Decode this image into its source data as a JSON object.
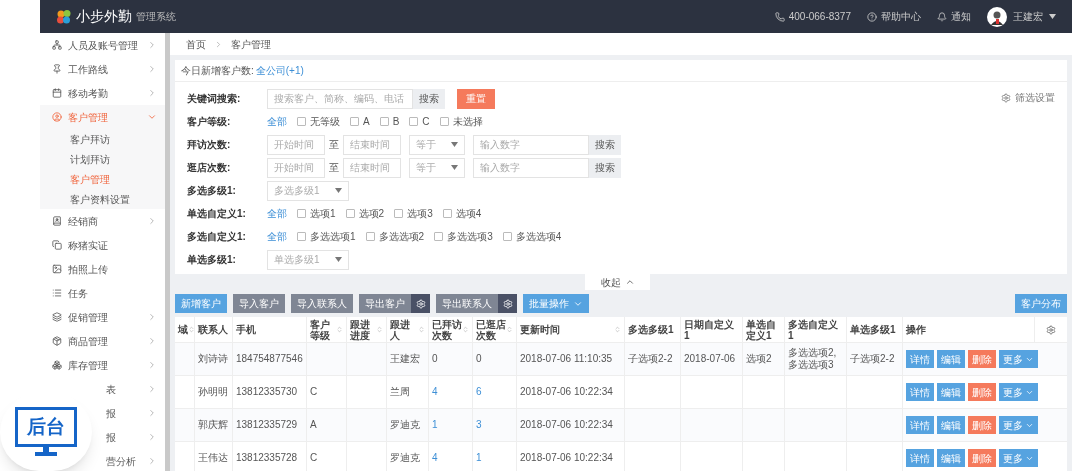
{
  "header": {
    "logo_text": "小步外勤",
    "subtitle": "管理系统",
    "phone": "400-066-8377",
    "help": "帮助中心",
    "notify": "通知",
    "user": "王建宏"
  },
  "sidebar": {
    "items": [
      {
        "label": "人员及账号管理",
        "expanded": false,
        "selected": false
      },
      {
        "label": "工作路线",
        "expanded": false,
        "selected": false
      },
      {
        "label": "移动考勤",
        "expanded": false,
        "selected": false
      },
      {
        "label": "客户管理",
        "expanded": true,
        "selected": true,
        "children": [
          {
            "label": "客户拜访",
            "selected": false
          },
          {
            "label": "计划拜访",
            "selected": false
          },
          {
            "label": "客户管理",
            "selected": true
          },
          {
            "label": "客户资料设置",
            "selected": false
          }
        ]
      },
      {
        "label": "经销商",
        "expanded": false,
        "selected": false
      },
      {
        "label": "称猪实证",
        "selected": false
      },
      {
        "label": "拍照上传",
        "selected": false
      },
      {
        "label": "任务",
        "selected": false
      },
      {
        "label": "促销管理",
        "expanded": false,
        "selected": false
      },
      {
        "label": "商品管理",
        "expanded": false,
        "selected": false
      },
      {
        "label": "库存管理",
        "expanded": false,
        "selected": false
      },
      {
        "label": "表",
        "expanded": false,
        "covered": true
      },
      {
        "label": "报",
        "expanded": false,
        "covered": true
      },
      {
        "label": "报",
        "expanded": false,
        "covered": true
      },
      {
        "label": "营分析",
        "expanded": false,
        "covered": true
      }
    ]
  },
  "badge": {
    "label": "后台"
  },
  "breadcrumb": [
    "首页",
    "客户管理"
  ],
  "today": {
    "label": "今日新增客户数:",
    "link": "全公司(+1)"
  },
  "filter_settings": "筛选设置",
  "filters": [
    {
      "kind": "search",
      "label": "关键词搜索:",
      "placeholder": "搜索客户、简称、编码、电话",
      "button": "搜索",
      "reset": "重置"
    },
    {
      "kind": "options",
      "label": "客户等级:",
      "all": "全部",
      "options": [
        {
          "label": "无等级",
          "checked": false
        },
        {
          "label": "A",
          "checked": false
        },
        {
          "label": "B",
          "checked": false
        },
        {
          "label": "C",
          "checked": false
        },
        {
          "label": "未选择",
          "checked": false
        }
      ]
    },
    {
      "kind": "range",
      "label": "拜访次数:",
      "start": "开始时间",
      "sep": "至",
      "end": "结束时间",
      "operator": "等于",
      "number": "输入数字",
      "button": "搜索"
    },
    {
      "kind": "range",
      "label": "逛店次数:",
      "start": "开始时间",
      "sep": "至",
      "end": "结束时间",
      "operator": "等于",
      "number": "输入数字",
      "button": "搜索"
    },
    {
      "kind": "select",
      "label": "多选多级1:",
      "placeholder": "多选多级1"
    },
    {
      "kind": "options",
      "label": "单选自定义1:",
      "all": "全部",
      "options": [
        {
          "label": "选项1",
          "checked": false
        },
        {
          "label": "选项2",
          "checked": false
        },
        {
          "label": "选项3",
          "checked": false
        },
        {
          "label": "选项4",
          "checked": false
        }
      ]
    },
    {
      "kind": "options",
      "label": "多选自定义1:",
      "all": "全部",
      "options": [
        {
          "label": "多选选项1",
          "checked": false
        },
        {
          "label": "多选选项2",
          "checked": false
        },
        {
          "label": "多选选项3",
          "checked": false
        },
        {
          "label": "多选选项4",
          "checked": false
        }
      ]
    },
    {
      "kind": "select",
      "label": "单选多级1:",
      "placeholder": "单选多级1"
    }
  ],
  "collapse": "收起",
  "toolbar": [
    {
      "kind": "primary",
      "label": "新增客户"
    },
    {
      "kind": "secondary",
      "label": "导入客户"
    },
    {
      "kind": "secondary",
      "label": "导入联系人"
    },
    {
      "kind": "split",
      "label": "导出客户"
    },
    {
      "kind": "split",
      "label": "导出联系人"
    },
    {
      "kind": "dropdown",
      "label": "批量操作"
    }
  ],
  "map_button": "客户分布",
  "table": {
    "columns": [
      {
        "label": "域",
        "sortable": true
      },
      {
        "label": "联系人",
        "sortable": false
      },
      {
        "label": "手机",
        "sortable": false
      },
      {
        "label": "客户等级",
        "sortable": true
      },
      {
        "label": "跟进进度",
        "sortable": true
      },
      {
        "label": "跟进人",
        "sortable": true
      },
      {
        "label": "已拜访次数",
        "sortable": true
      },
      {
        "label": "已逛店次数",
        "sortable": true
      },
      {
        "label": "更新时间",
        "sortable": true
      },
      {
        "label": "多选多级1",
        "sortable": false
      },
      {
        "label": "日期自定义1",
        "sortable": false
      },
      {
        "label": "单选自定义1",
        "sortable": false
      },
      {
        "label": "多选自定义1",
        "sortable": false
      },
      {
        "label": "单选多级1",
        "sortable": false
      },
      {
        "label": "操作",
        "sortable": false
      }
    ],
    "rows": [
      {
        "counts_linked": false,
        "cells": [
          "",
          "刘诗诗",
          "184754877546",
          "",
          "",
          "王建宏",
          "0",
          "0",
          "2018-07-06 11:10:35",
          "子选项2-2",
          "2018-07-06",
          "选项2",
          "多选选项2,多选选项3",
          "子选项2-2"
        ],
        "actions": [
          {
            "kind": "info",
            "label": "详情"
          },
          {
            "kind": "info",
            "label": "编辑"
          },
          {
            "kind": "danger",
            "label": "删除"
          },
          {
            "kind": "more",
            "label": "更多"
          }
        ]
      },
      {
        "counts_linked": true,
        "cells": [
          "",
          "孙明明",
          "13812335730",
          "C",
          "",
          "兰周",
          "4",
          "6",
          "2018-07-06 10:22:34",
          "",
          "",
          "",
          "",
          ""
        ],
        "actions": [
          {
            "kind": "info",
            "label": "详情"
          },
          {
            "kind": "info",
            "label": "编辑"
          },
          {
            "kind": "danger",
            "label": "删除"
          },
          {
            "kind": "more",
            "label": "更多"
          }
        ]
      },
      {
        "counts_linked": true,
        "cells": [
          "",
          "郭庆辉",
          "13812335729",
          "A",
          "",
          "罗迪克",
          "1",
          "3",
          "2018-07-06 10:22:34",
          "",
          "",
          "",
          "",
          ""
        ],
        "actions": [
          {
            "kind": "info",
            "label": "详情"
          },
          {
            "kind": "info",
            "label": "编辑"
          },
          {
            "kind": "danger",
            "label": "删除"
          },
          {
            "kind": "more",
            "label": "更多"
          }
        ]
      },
      {
        "counts_linked": true,
        "cells": [
          "",
          "王伟达",
          "13812335728",
          "C",
          "",
          "罗迪克",
          "4",
          "1",
          "2018-07-06 10:22:34",
          "",
          "",
          "",
          "",
          ""
        ],
        "actions": [
          {
            "kind": "info",
            "label": "详情"
          },
          {
            "kind": "info",
            "label": "编辑"
          },
          {
            "kind": "danger",
            "label": "删除"
          },
          {
            "kind": "more",
            "label": "更多"
          }
        ]
      }
    ]
  }
}
